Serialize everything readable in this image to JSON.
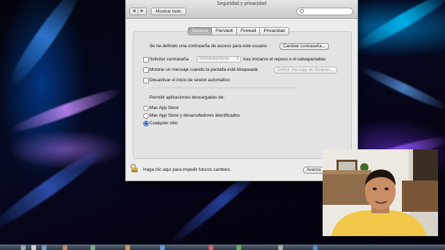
{
  "window": {
    "title": "Seguridad y privacidad",
    "show_all": "Mostrar todo"
  },
  "tabs": [
    "General",
    "FileVault",
    "Firewall",
    "Privacidad"
  ],
  "active_tab": "General",
  "general": {
    "password_text": "Se ha definido una contraseña de acceso para este usuario",
    "change_password_button": "Cambiar contraseña...",
    "require_password_label": "Solicitar contraseña",
    "require_password_select": "inmediatamente",
    "require_password_suffix": "tras iniciarse el reposo o el salvapantallas",
    "show_message_label": "Mostrar un mensaje cuando la pantalla esté bloqueada",
    "set_lock_message_button": "Definir mensaje de bloqueo...",
    "disable_autologin_label": "Desactivar el inicio de sesión automático",
    "downloads_heading": "Permitir aplicaciones descargadas de:",
    "download_options": [
      "Mac App Store",
      "Mac App Store y desarrolladores identificados",
      "Cualquier sitio"
    ],
    "download_selected": "Cualquier sitio"
  },
  "footer": {
    "lock_text": "Haga clic aquí para impedir futuros cambios.",
    "advanced_button": "Avanza"
  },
  "icons": {
    "back": "chevron-left-icon",
    "forward": "chevron-right-icon",
    "search": "search-icon",
    "lock": "unlocked-padlock-icon"
  },
  "colors": {
    "window_bg": "#ececec",
    "active_tab": "#9d9d9d",
    "radio_selected": "#1d3f8f"
  }
}
